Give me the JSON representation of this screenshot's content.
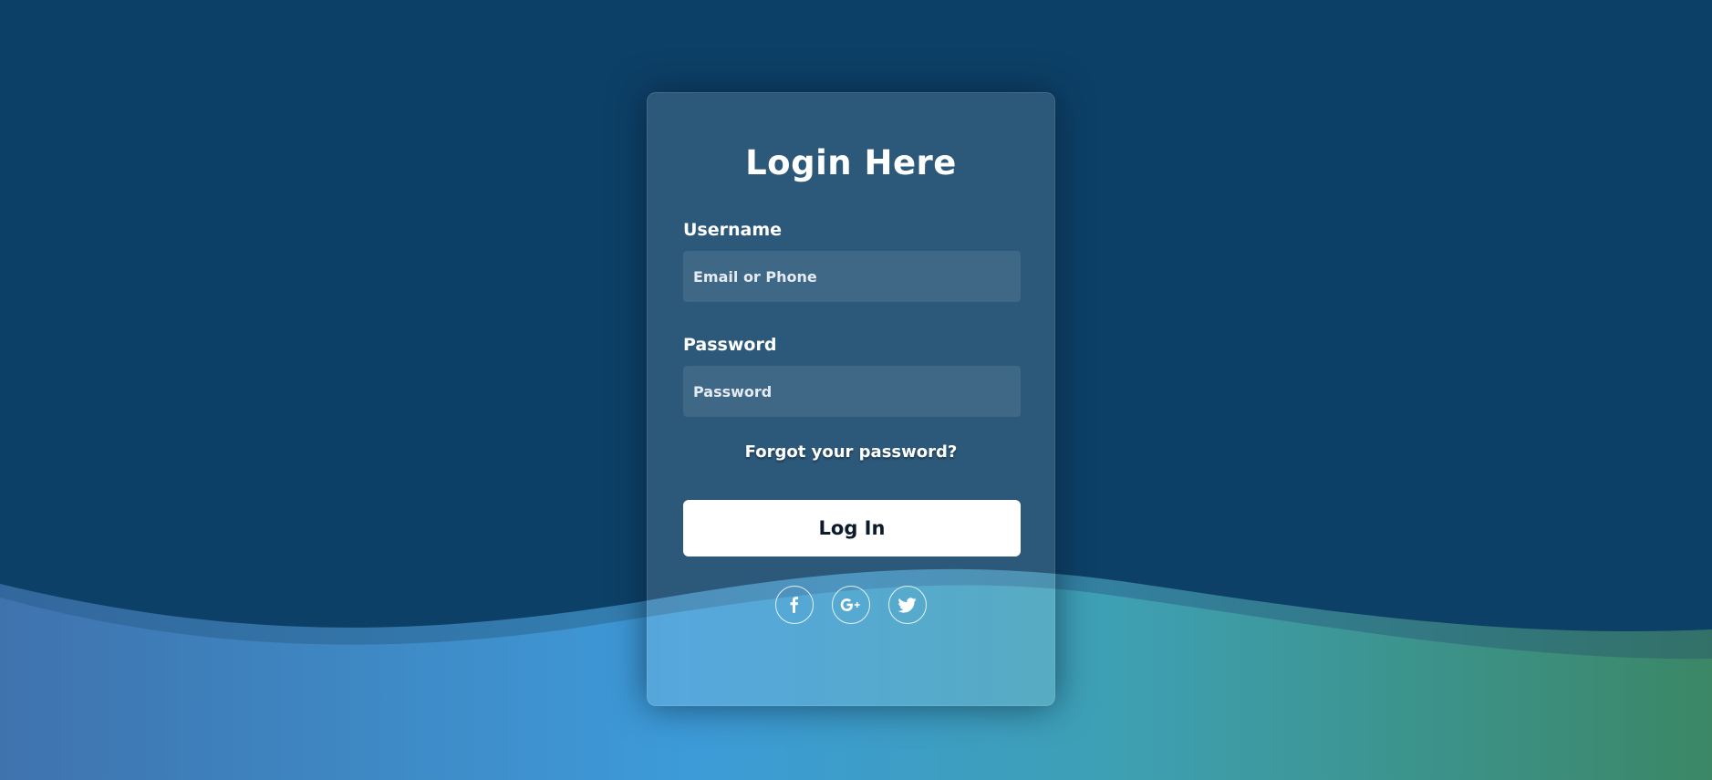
{
  "login": {
    "title": "Login Here",
    "username_label": "Username",
    "username_placeholder": "Email or Phone",
    "password_label": "Password",
    "password_placeholder": "Password",
    "forgot_link": "Forgot your password?",
    "submit_label": "Log In"
  },
  "social": {
    "items": [
      {
        "name": "facebook",
        "icon": "facebook-icon",
        "glyph": "f"
      },
      {
        "name": "google-plus",
        "icon": "google-plus-icon",
        "glyph": "G+"
      },
      {
        "name": "twitter",
        "icon": "twitter-icon",
        "glyph": "bird"
      }
    ]
  },
  "colors": {
    "background": "#0d4067",
    "wave_left": "#3f7ab6",
    "wave_middle": "#3c9ad6",
    "wave_right": "#3b8a6b",
    "button_bg": "#ffffff",
    "button_text": "#0b1b2b"
  }
}
